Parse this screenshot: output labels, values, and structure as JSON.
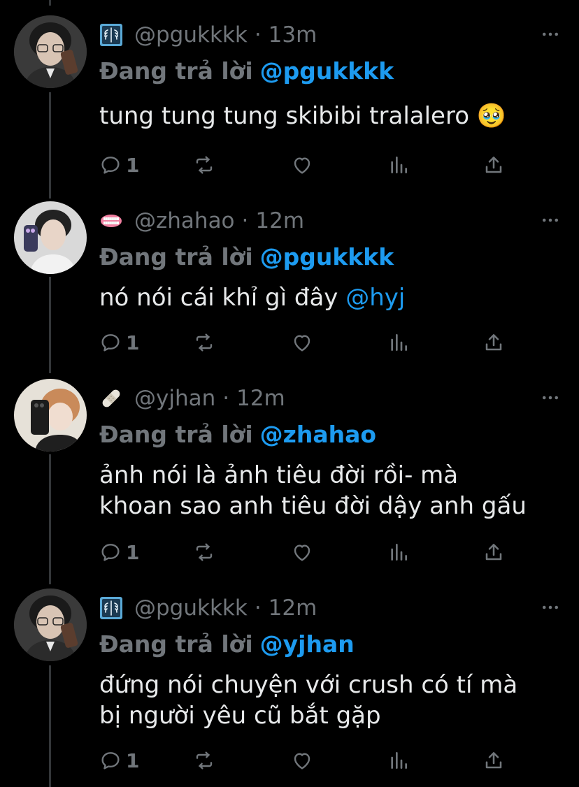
{
  "reply_prefix": "Đang trả lời",
  "separator": "·",
  "icons": {
    "reply": "reply-bubble-icon",
    "retweet": "retweet-icon",
    "like": "heart-icon",
    "views": "views-bars-icon",
    "share": "share-upload-icon",
    "more": "more-dots-icon"
  },
  "colors": {
    "background": "#000000",
    "text": "#e7e9ea",
    "muted": "#71767b",
    "accent": "#1d9bf0",
    "thread_line": "#333639"
  },
  "tweets": [
    {
      "handle": "@pgukkkk",
      "time": "13m",
      "badge": "x-ray-emoji",
      "replying_to": "@pgukkkk",
      "text_line1": "tung tung tung skibibi tralalero 🥹",
      "text_line2": "",
      "text_mention": "",
      "reply_count": "1"
    },
    {
      "handle": "@zhahao",
      "time": "12m",
      "badge": "mouth-guard-emoji",
      "replying_to": "@pgukkkk",
      "text_line1": "nó nói cái khỉ gì đây ",
      "text_line2": "",
      "text_mention": "@hyj",
      "reply_count": "1"
    },
    {
      "handle": "@yjhan",
      "time": "12m",
      "badge": "bandage-emoji",
      "replying_to": "@zhahao",
      "text_line1": "ảnh nói là ảnh tiêu đời rồi- mà",
      "text_line2": "khoan sao anh tiêu đời dậy anh gấu",
      "text_mention": "",
      "reply_count": "1"
    },
    {
      "handle": "@pgukkkk",
      "time": "12m",
      "badge": "x-ray-emoji",
      "replying_to": "@yjhan",
      "text_line1": "đứng nói chuyện với crush có tí mà",
      "text_line2": "bị người yêu cũ bắt gặp",
      "text_mention": "",
      "reply_count": "1"
    }
  ]
}
